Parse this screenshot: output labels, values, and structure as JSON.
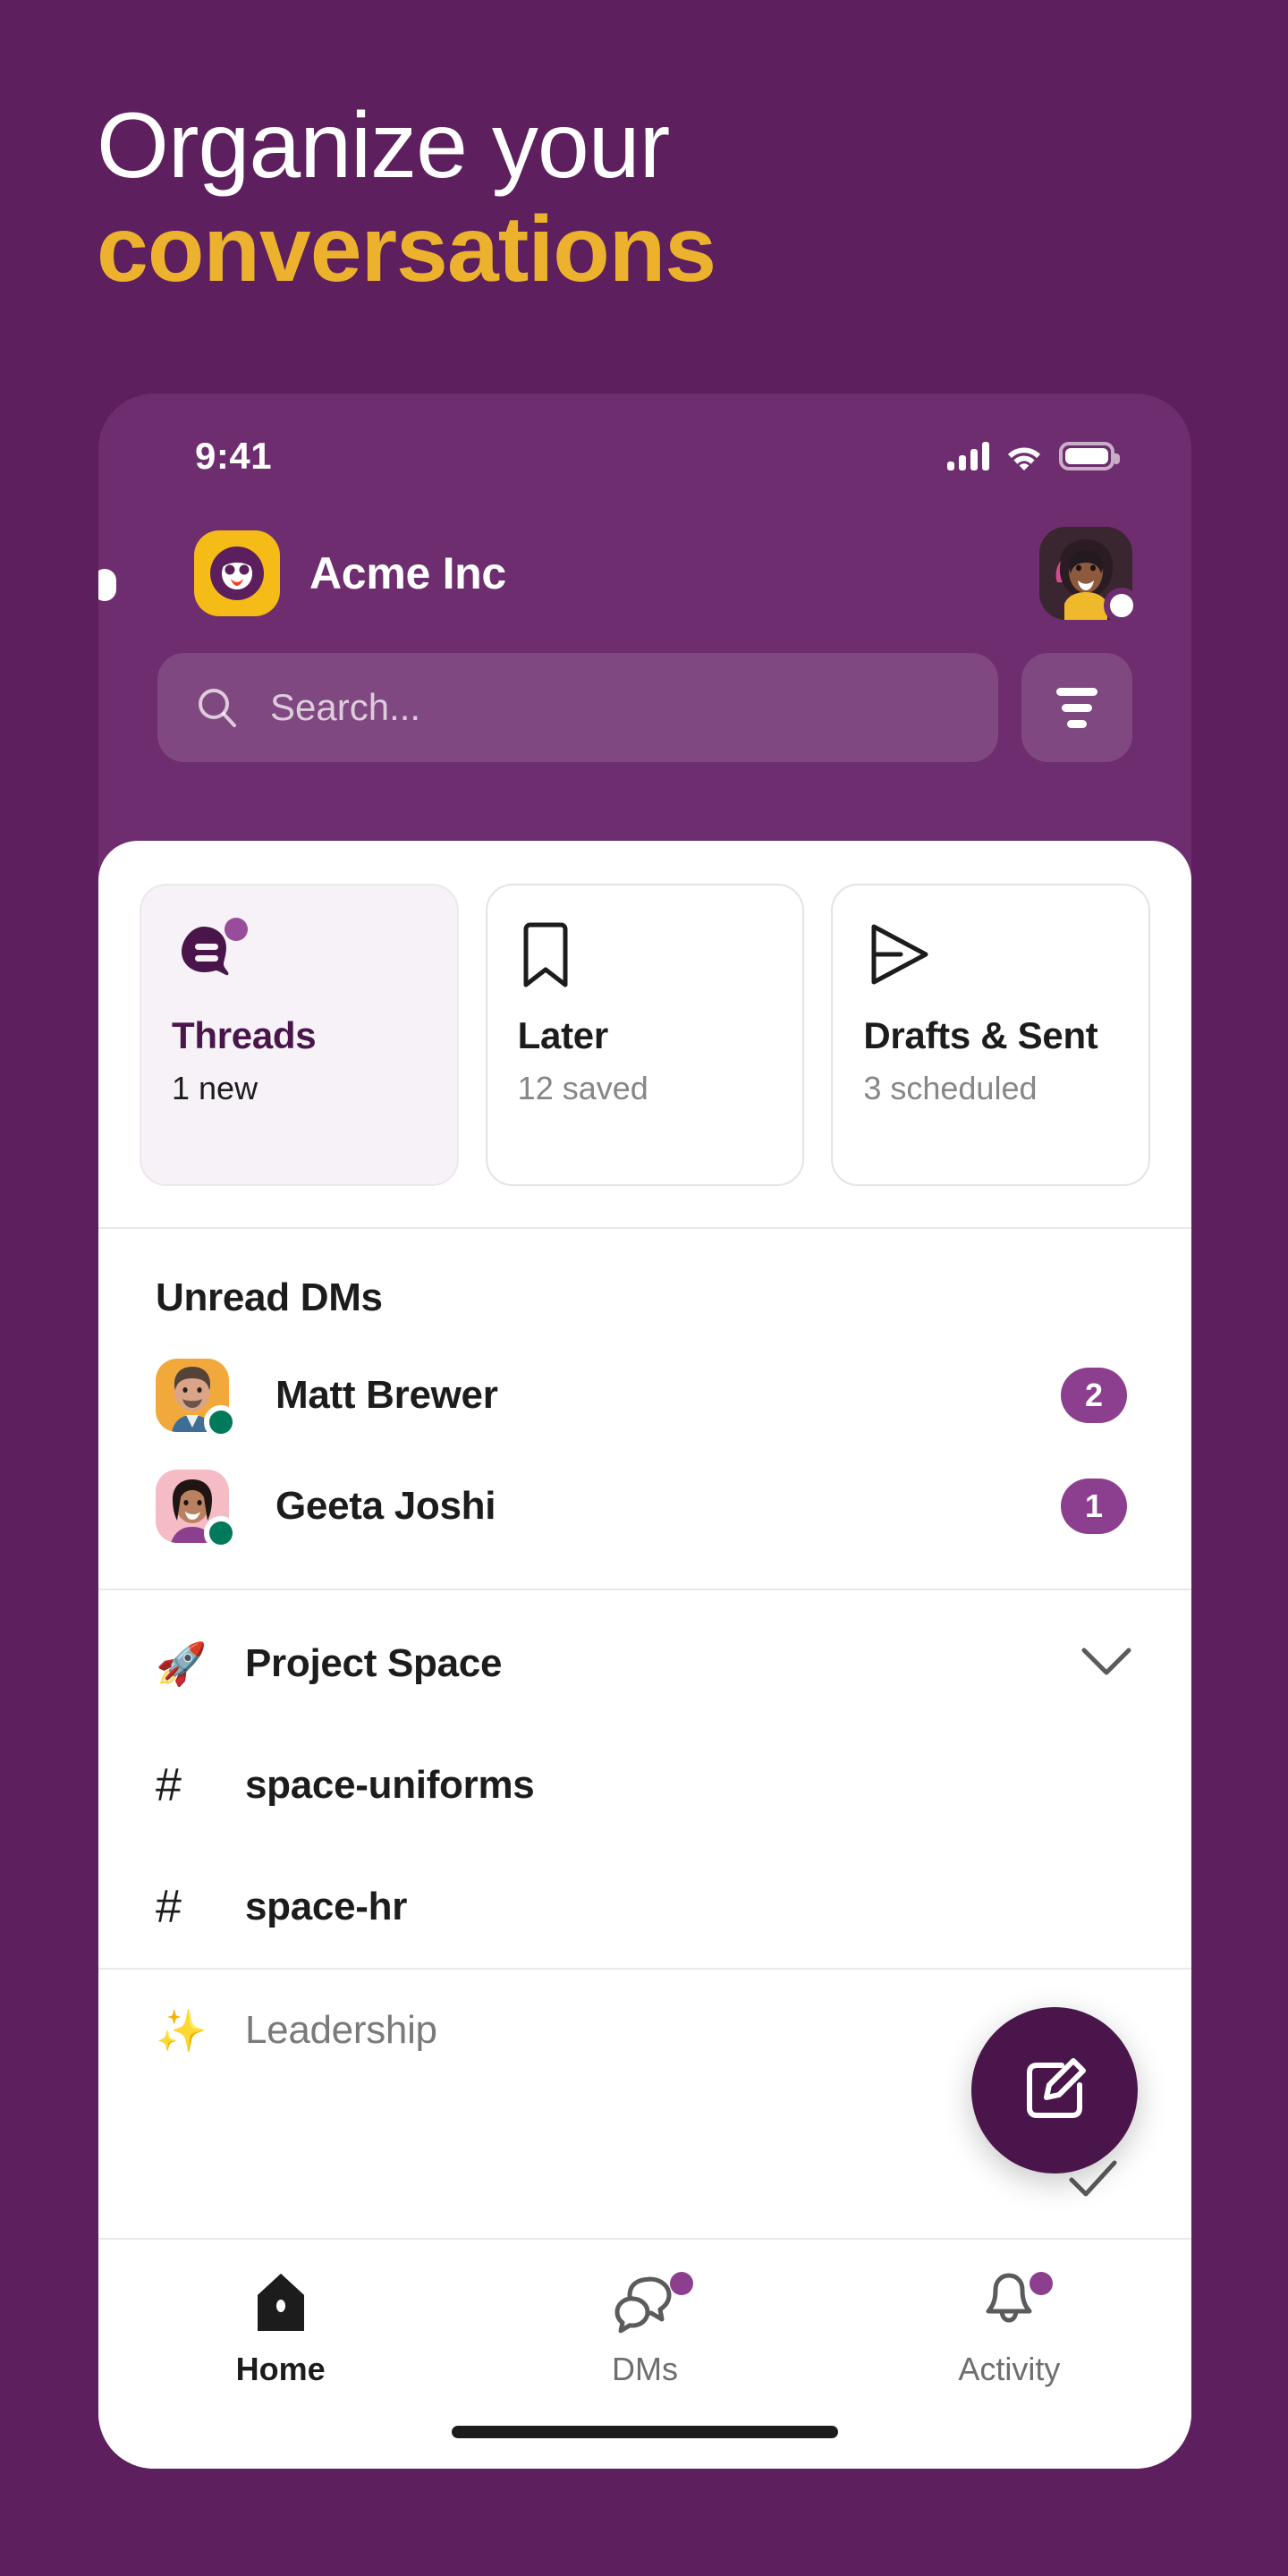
{
  "marketing": {
    "headline_line1": "Organize your",
    "headline_line2": "conversations",
    "bg_color": "#5D1F5D",
    "accent_color": "#ECB22E"
  },
  "status_bar": {
    "time": "9:41",
    "icons": [
      "cellular-signal-icon",
      "wifi-icon",
      "battery-icon"
    ]
  },
  "app_header": {
    "workspace_name": "Acme Inc",
    "workspace_logo": "acme-logo-icon",
    "avatar": "user-avatar",
    "presence": "away"
  },
  "search": {
    "placeholder": "Search...",
    "icon": "search-icon",
    "filter_icon": "filter-icon"
  },
  "shortcut_cards": [
    {
      "icon": "threads-icon",
      "title": "Threads",
      "subtitle": "1 new",
      "active": true,
      "has_badge": true
    },
    {
      "icon": "bookmark-icon",
      "title": "Later",
      "subtitle": "12 saved",
      "active": false,
      "has_badge": false
    },
    {
      "icon": "paper-plane-icon",
      "title": "Drafts & Sent",
      "subtitle": "3 scheduled",
      "active": false,
      "has_badge": false
    }
  ],
  "unread_dms": {
    "section_title": "Unread DMs",
    "items": [
      {
        "name": "Matt Brewer",
        "count": "2",
        "presence": "active"
      },
      {
        "name": "Geeta Joshi",
        "count": "1",
        "presence": "active"
      }
    ]
  },
  "channels": [
    {
      "emoji": "🚀",
      "name": "Project Space",
      "type": "section",
      "collapse_icon": "chevron-down-icon"
    },
    {
      "prefix": "#",
      "name": "space-uniforms",
      "type": "channel"
    },
    {
      "prefix": "#",
      "name": "space-hr",
      "type": "channel"
    },
    {
      "emoji": "✨",
      "name": "Leadership",
      "type": "section-muted"
    }
  ],
  "fab": {
    "icon": "compose-icon",
    "color": "#4A154B"
  },
  "bottom_nav": [
    {
      "label": "Home",
      "icon": "home-icon",
      "active": true,
      "dot": false
    },
    {
      "label": "DMs",
      "icon": "dms-icon",
      "active": false,
      "dot": true
    },
    {
      "label": "Activity",
      "icon": "bell-icon",
      "active": false,
      "dot": true
    }
  ],
  "badge_color": "#8D3F8F",
  "presence_color": "#007A5A"
}
